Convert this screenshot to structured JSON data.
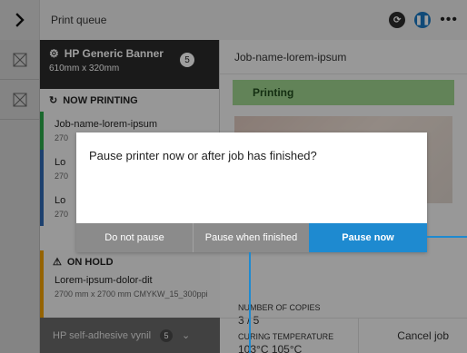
{
  "topbar": {
    "title": "Print queue"
  },
  "queue": {
    "header_name": "HP Generic Banner",
    "header_dims": "610mm x 320mm",
    "header_badge": "5",
    "now_printing": "NOW PRINTING",
    "job1_name": "Job-name-lorem-ipsum",
    "job1_sub": "270",
    "job2_name": "Lo",
    "job2_sub": "270",
    "job3_name": "Lo",
    "job3_sub": "270",
    "on_hold_title": "ON HOLD",
    "on_hold_job": "Lorem-ipsum-dolor-dit",
    "on_hold_sub": "2700 mm x 2700 mm   CMYKW_15_300ppi",
    "bottom_name": "HP self-adhesive vynil",
    "bottom_badge": "5"
  },
  "detail": {
    "jobname": "Job-name-lorem-ipsum",
    "status": "Printing",
    "copies_label": "NUMBER OF COPIES",
    "copies_value": "3 / 5",
    "temp_label": "CURING TEMPERATURE",
    "temp_value": "103°C   105°C",
    "cancel_label": "Cancel job"
  },
  "dialog": {
    "message": "Pause printer now or after job has finished?",
    "btn_do_not_pause": "Do not pause",
    "btn_pause_when_finished": "Pause when finished",
    "btn_pause_now": "Pause now"
  }
}
